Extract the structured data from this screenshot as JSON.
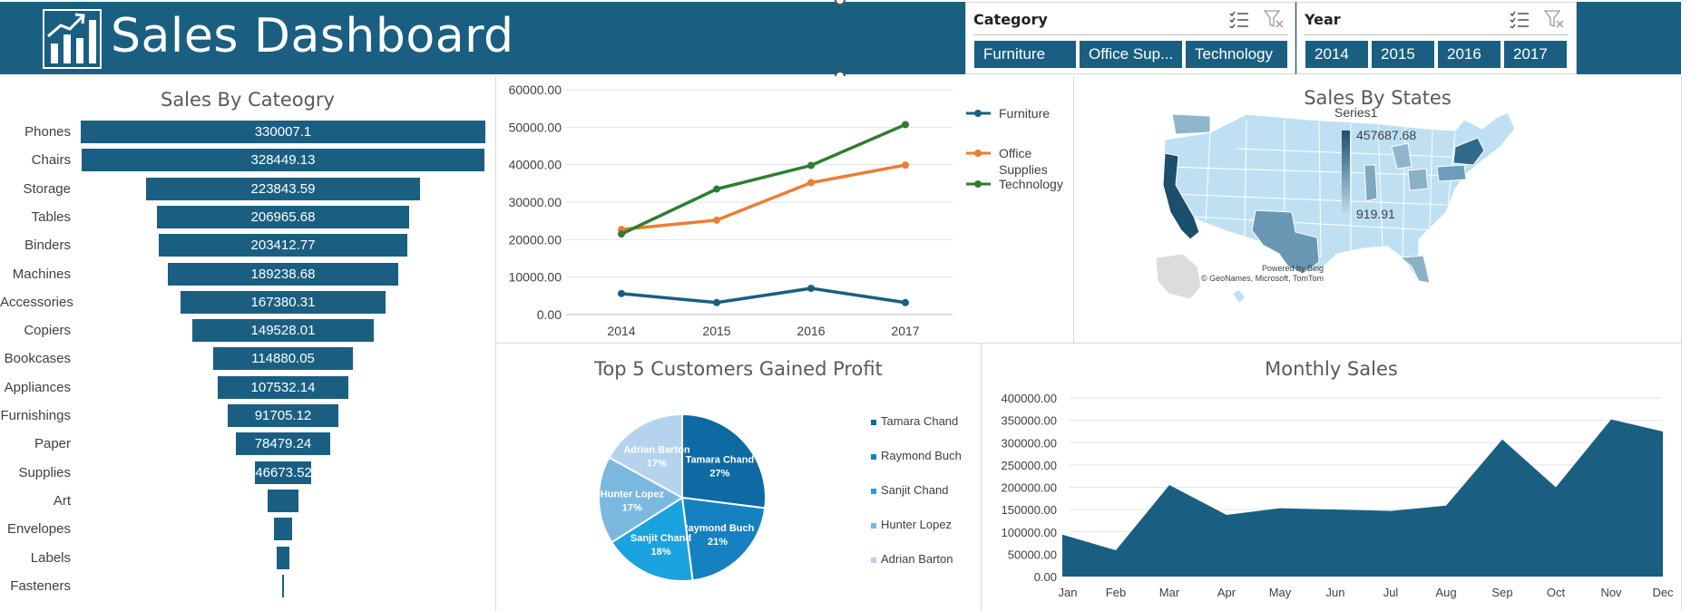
{
  "header": {
    "title": "Sales Dashboard",
    "logo_icon": "bar-chart-up-icon"
  },
  "slicers": {
    "category": {
      "title": "Category",
      "items": [
        "Furniture",
        "Office Sup...",
        "Technology"
      ]
    },
    "year": {
      "title": "Year",
      "items": [
        "2014",
        "2015",
        "2016",
        "2017"
      ]
    }
  },
  "colors": {
    "brand": "#1a5f82",
    "furniture": "#1a5f82",
    "office_supplies": "#ed7d31",
    "technology": "#2e7d32"
  },
  "chart_data": [
    {
      "id": "sales_by_category",
      "type": "bar",
      "title": "Sales By Cateogry",
      "categories": [
        "Phones",
        "Chairs",
        "Storage",
        "Tables",
        "Binders",
        "Machines",
        "Accessories",
        "Copiers",
        "Bookcases",
        "Appliances",
        "Furnishings",
        "Paper",
        "Supplies",
        "Art",
        "Envelopes",
        "Labels",
        "Fasteners"
      ],
      "values": [
        330007.1,
        328449.13,
        223843.59,
        206965.68,
        203412.77,
        189238.68,
        167380.31,
        149528.01,
        114880.05,
        107532.14,
        91705.12,
        78479.24,
        46673.52,
        27118.79,
        16476.4,
        12486.31,
        3024.28
      ],
      "labels": [
        "330007.1",
        "328449.13",
        "223843.59",
        "206965.68",
        "203412.77",
        "189238.68",
        "167380.31",
        "149528.01",
        "114880.05",
        "107532.14",
        "91705.12",
        "78479.24",
        "46673.52",
        "",
        "",
        "",
        ""
      ]
    },
    {
      "id": "sales_by_year",
      "type": "line",
      "title": "",
      "categories": [
        "2014",
        "2015",
        "2016",
        "2017"
      ],
      "ylim": [
        0,
        60000
      ],
      "yticks": [
        "0.00",
        "10000.00",
        "20000.00",
        "30000.00",
        "40000.00",
        "50000.00",
        "60000.00"
      ],
      "legend_position": "right",
      "series": [
        {
          "name": "Furniture",
          "values": [
            5600,
            3200,
            7000,
            3200
          ]
        },
        {
          "name": "Office Supplies",
          "values": [
            22700,
            25200,
            35200,
            39900
          ]
        },
        {
          "name": "Technology",
          "values": [
            21500,
            33500,
            39800,
            50700
          ]
        }
      ]
    },
    {
      "id": "sales_by_states",
      "type": "heatmap",
      "title": "Sales By States",
      "legend_title": "Series1",
      "max_label": "457687.68",
      "min_label": "919.91",
      "attribution": [
        "Powered by Bing",
        "© GeoNames, Microsoft, TomTom"
      ]
    },
    {
      "id": "top_customers",
      "type": "pie",
      "title": "Top 5 Customers Gained Profit",
      "categories": [
        "Tamara Chand",
        "Raymond Buch",
        "Sanjit Chand",
        "Hunter Lopez",
        "Adrian Barton"
      ],
      "values": [
        27,
        21,
        18,
        17,
        17
      ],
      "labels": [
        "27%",
        "21%",
        "18%",
        "17%",
        "17%"
      ],
      "legend_position": "right"
    },
    {
      "id": "monthly_sales",
      "type": "area",
      "title": "Monthly Sales",
      "categories": [
        "Jan",
        "Feb",
        "Mar",
        "Apr",
        "May",
        "Jun",
        "Jul",
        "Aug",
        "Sep",
        "Oct",
        "Nov",
        "Dec"
      ],
      "values": [
        94000,
        59000,
        205000,
        138000,
        153000,
        150000,
        147000,
        159000,
        307000,
        200000,
        352000,
        325000
      ],
      "ylim": [
        0,
        400000
      ],
      "yticks": [
        "0.00",
        "50000.00",
        "100000.00",
        "150000.00",
        "200000.00",
        "250000.00",
        "300000.00",
        "350000.00",
        "400000.00"
      ]
    }
  ]
}
